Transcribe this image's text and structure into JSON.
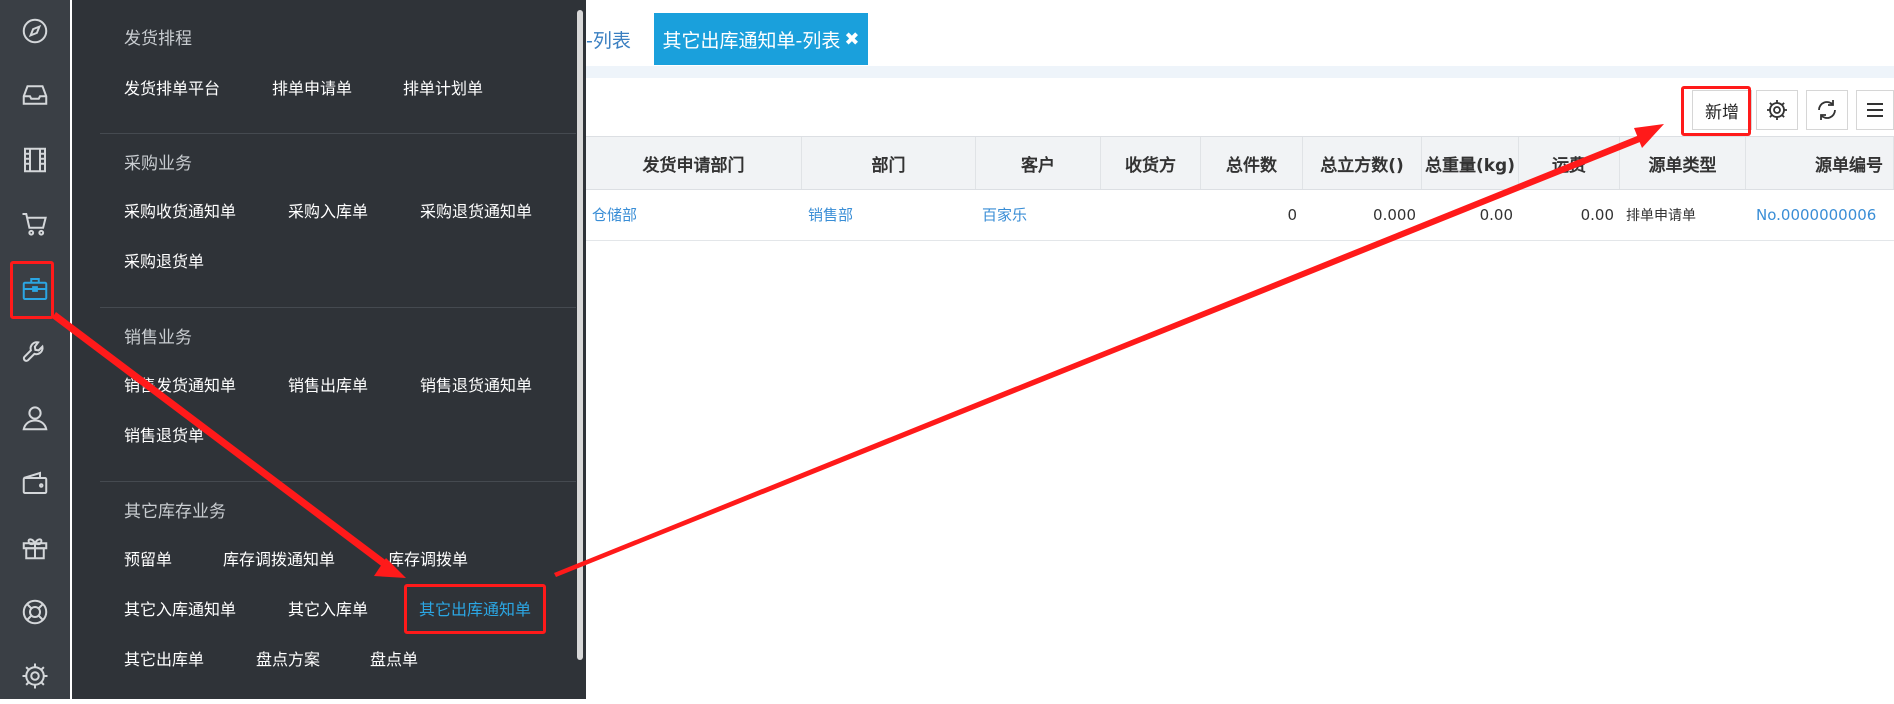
{
  "rail": {
    "items": [
      {
        "icon": "compass-icon",
        "active": false
      },
      {
        "icon": "inbox-icon",
        "active": false
      },
      {
        "icon": "film-icon",
        "active": false
      },
      {
        "icon": "cart-icon",
        "active": false
      },
      {
        "icon": "briefcase-icon",
        "active": true
      },
      {
        "icon": "wrench-icon",
        "active": false
      },
      {
        "icon": "user-icon",
        "active": false
      },
      {
        "icon": "wallet-icon",
        "active": false
      },
      {
        "icon": "gift-icon",
        "active": false
      },
      {
        "icon": "lifebuoy-icon",
        "active": false
      },
      {
        "icon": "gear-icon",
        "active": false
      }
    ]
  },
  "menu": {
    "groups": [
      {
        "title": "发货排程",
        "items": [
          "发货排单平台",
          "排单申请单",
          "排单计划单"
        ]
      },
      {
        "title": "采购业务",
        "items": [
          "采购收货通知单",
          "采购入库单",
          "采购退货通知单",
          "采购退货单"
        ]
      },
      {
        "title": "销售业务",
        "items": [
          "销售发货通知单",
          "销售出库单",
          "销售退货通知单",
          "销售退货单"
        ]
      },
      {
        "title": "其它库存业务",
        "items": [
          "预留单",
          "库存调拨通知单",
          "库存调拨单",
          "其它入库通知单",
          "其它入库单",
          "其它出库通知单",
          "其它出库单",
          "盘点方案",
          "盘点单"
        ]
      }
    ],
    "active_item": "其它出库通知单"
  },
  "tabs": {
    "inactive_label": "-列表",
    "active_label": "其它出库通知单-列表",
    "close_glyph": "✖"
  },
  "toolbar": {
    "add_label": "新增"
  },
  "table": {
    "columns": [
      "发货申请部门",
      "部门",
      "客户",
      "收货方",
      "总件数",
      "总立方数()",
      "总重量(kg)",
      "运费",
      "源单类型",
      "源单编号"
    ],
    "rows": [
      {
        "apply_dept": "仓储部",
        "dept": "销售部",
        "customer": "百家乐",
        "receiver": "",
        "total_count": "0",
        "total_volume": "0.000",
        "total_weight": "0.00",
        "freight": "0.00",
        "source_type": "排单申请单",
        "source_no": "No.0000000006"
      }
    ]
  },
  "colors": {
    "rail_bg": "#3a3f45",
    "flyout_bg": "#2f3338",
    "accent": "#1aa0dc",
    "highlight": "#ff1a1a",
    "link": "#3a8ed6"
  }
}
